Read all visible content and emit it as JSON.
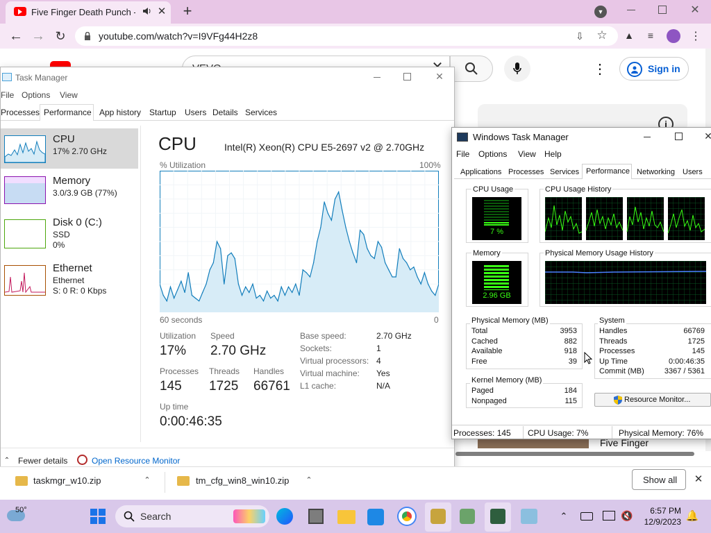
{
  "browser": {
    "tab_title": "Five Finger Death Punch - W",
    "url": "youtube.com/watch?v=I9VFg44H2z8",
    "search_text": "VEVO",
    "sign_in": "Sign in",
    "video_title": "Five Finger"
  },
  "tm10": {
    "title": "Task Manager",
    "menu": [
      "File",
      "Options",
      "View"
    ],
    "tabs": [
      "Processes",
      "Performance",
      "App history",
      "Startup",
      "Users",
      "Details",
      "Services"
    ],
    "side": [
      {
        "name": "CPU",
        "sub1": "17% 2.70 GHz",
        "sub2": ""
      },
      {
        "name": "Memory",
        "sub1": "3.0/3.9 GB (77%)",
        "sub2": ""
      },
      {
        "name": "Disk 0 (C:)",
        "sub1": "SSD",
        "sub2": "0%"
      },
      {
        "name": "Ethernet",
        "sub1": "Ethernet",
        "sub2": "S: 0 R: 0 Kbps"
      }
    ],
    "heading": "CPU",
    "processor": "Intel(R) Xeon(R) CPU E5-2697 v2 @ 2.70GHz",
    "util_label": "% Utilization",
    "util_max": "100%",
    "axis_left": "60 seconds",
    "axis_right": "0",
    "stats": {
      "utilization_label": "Utilization",
      "utilization": "17%",
      "speed_label": "Speed",
      "speed": "2.70 GHz",
      "processes_label": "Processes",
      "processes": "145",
      "threads_label": "Threads",
      "threads": "1725",
      "handles_label": "Handles",
      "handles": "66761",
      "uptime_label": "Up time",
      "uptime": "0:00:46:35"
    },
    "details": [
      {
        "k": "Base speed:",
        "v": "2.70 GHz"
      },
      {
        "k": "Sockets:",
        "v": "1"
      },
      {
        "k": "Virtual processors:",
        "v": "4"
      },
      {
        "k": "Virtual machine:",
        "v": "Yes"
      },
      {
        "k": "L1 cache:",
        "v": "N/A"
      }
    ],
    "fewer_details": "Fewer details",
    "open_resmon": "Open Resource Monitor"
  },
  "chart_data": {
    "type": "area",
    "title": "% Utilization",
    "xlabel": "60 seconds",
    "ylim": [
      0,
      100
    ],
    "values": [
      20,
      12,
      8,
      18,
      10,
      16,
      22,
      14,
      28,
      12,
      10,
      8,
      14,
      20,
      30,
      35,
      50,
      45,
      20,
      40,
      42,
      38,
      20,
      12,
      18,
      14,
      20,
      10,
      12,
      8,
      15,
      10,
      12,
      8,
      18,
      12,
      18,
      14,
      20,
      12,
      30,
      28,
      25,
      35,
      50,
      60,
      78,
      70,
      65,
      80,
      85,
      72,
      60,
      50,
      42,
      35,
      58,
      55,
      45,
      40,
      38,
      50,
      46,
      35,
      30,
      25,
      25,
      45,
      38,
      35,
      30,
      32,
      25,
      20,
      28,
      20,
      15,
      12,
      20
    ],
    "color": "#117dbb",
    "fill": "#d7ecf7"
  },
  "tm7": {
    "title": "Windows Task Manager",
    "menu": [
      "File",
      "Options",
      "View",
      "Help"
    ],
    "tabs": [
      "Applications",
      "Processes",
      "Services",
      "Performance",
      "Networking",
      "Users"
    ],
    "cpu_usage": "CPU Usage",
    "cpu_pct": "7 %",
    "cpu_hist": "CPU Usage History",
    "memory": "Memory",
    "mem_val": "2.96 GB",
    "mem_hist": "Physical Memory Usage History",
    "phys_title": "Physical Memory (MB)",
    "phys": [
      {
        "k": "Total",
        "v": "3953"
      },
      {
        "k": "Cached",
        "v": "882"
      },
      {
        "k": "Available",
        "v": "918"
      },
      {
        "k": "Free",
        "v": "39"
      }
    ],
    "kernel_title": "Kernel Memory (MB)",
    "kernel": [
      {
        "k": "Paged",
        "v": "184"
      },
      {
        "k": "Nonpaged",
        "v": "115"
      }
    ],
    "sys_title": "System",
    "sys": [
      {
        "k": "Handles",
        "v": "66769"
      },
      {
        "k": "Threads",
        "v": "1725"
      },
      {
        "k": "Processes",
        "v": "145"
      },
      {
        "k": "Up Time",
        "v": "0:00:46:35"
      },
      {
        "k": "Commit (MB)",
        "v": "3367 / 5361"
      }
    ],
    "resmon": "Resource Monitor...",
    "status": [
      "Processes: 145",
      "CPU Usage: 7%",
      "Physical Memory: 76%"
    ]
  },
  "downloads": {
    "items": [
      "taskmgr_w10.zip",
      "tm_cfg_win8_win10.zip"
    ],
    "show_all": "Show all"
  },
  "taskbar": {
    "weather": "50°",
    "search": "Search",
    "time": "6:57 PM",
    "date": "12/9/2023"
  }
}
